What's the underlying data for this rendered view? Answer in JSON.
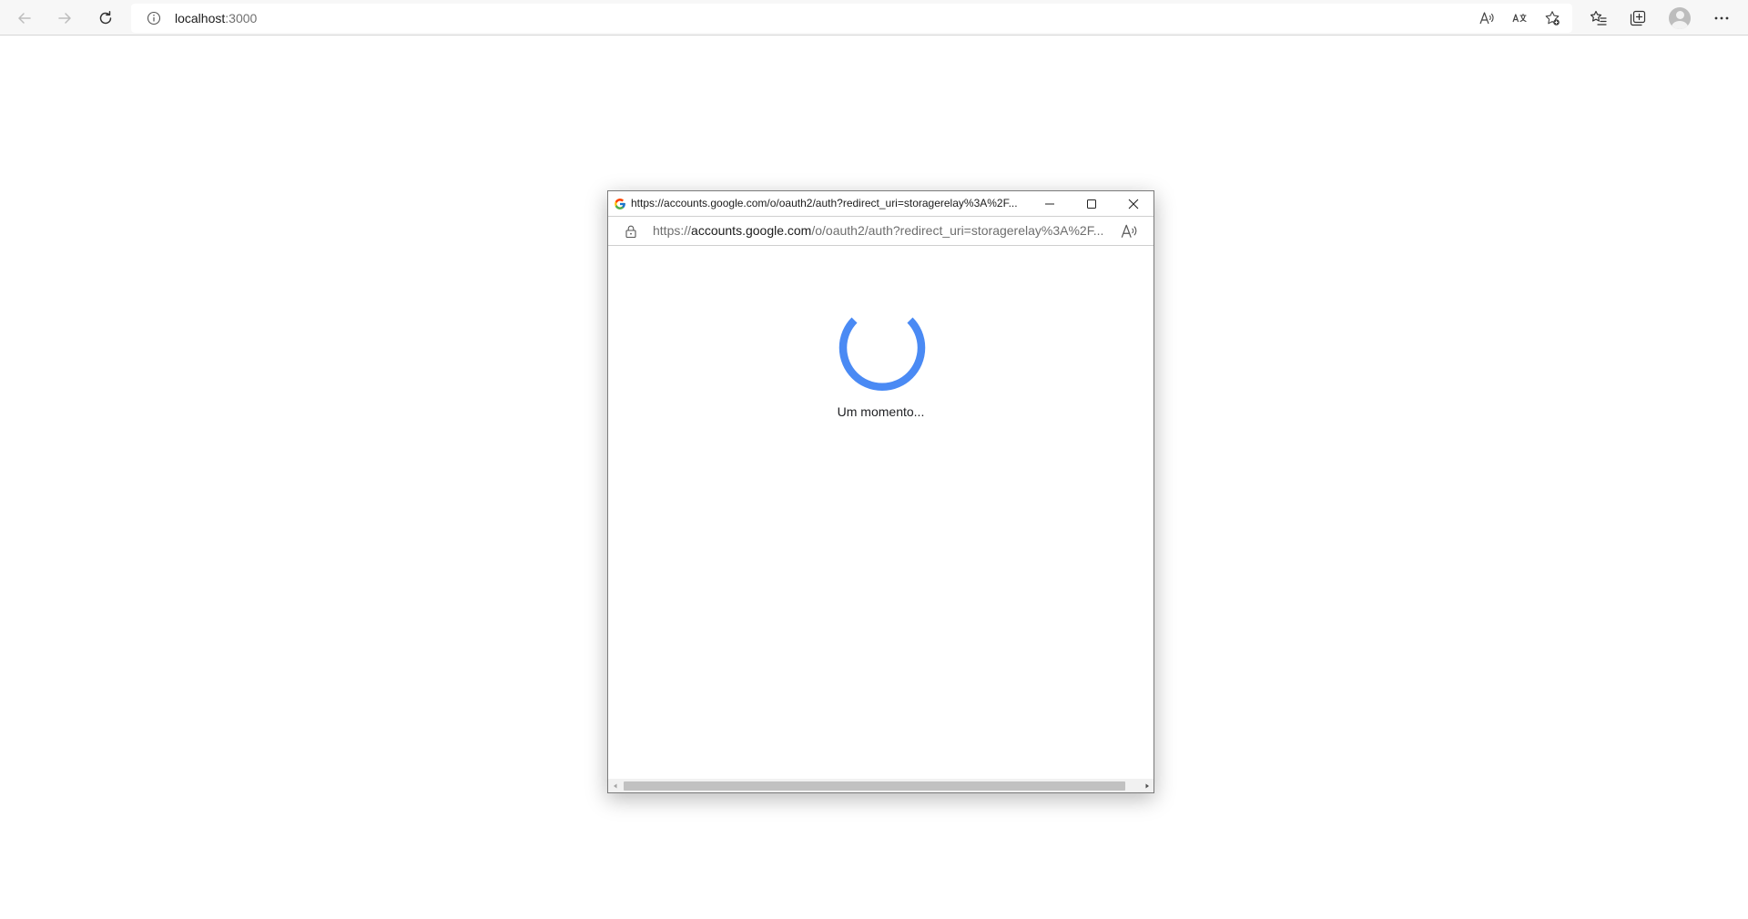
{
  "browser": {
    "address": {
      "host": "localhost",
      "port": ":3000"
    },
    "buttons": {
      "back": "arrow-left-icon",
      "forward": "arrow-right-icon",
      "refresh": "refresh-icon",
      "site_info": "info-icon",
      "read_aloud": "read-aloud-icon",
      "translate": "translate-icon",
      "add_favorite": "star-plus-icon",
      "favorites": "favorites-icon",
      "collections": "collections-icon",
      "profile": "avatar",
      "more": "more-icon"
    }
  },
  "popup": {
    "title": "https://accounts.google.com/o/oauth2/auth?redirect_uri=storagerelay%3A%2F...",
    "url": {
      "scheme": "https://",
      "host": "accounts.google.com",
      "path": "/o/oauth2/auth?redirect_uri=storagerelay%3A%2F..."
    },
    "loading_text": "Um momento...",
    "colors": {
      "spinner": "#4a8af4"
    }
  }
}
